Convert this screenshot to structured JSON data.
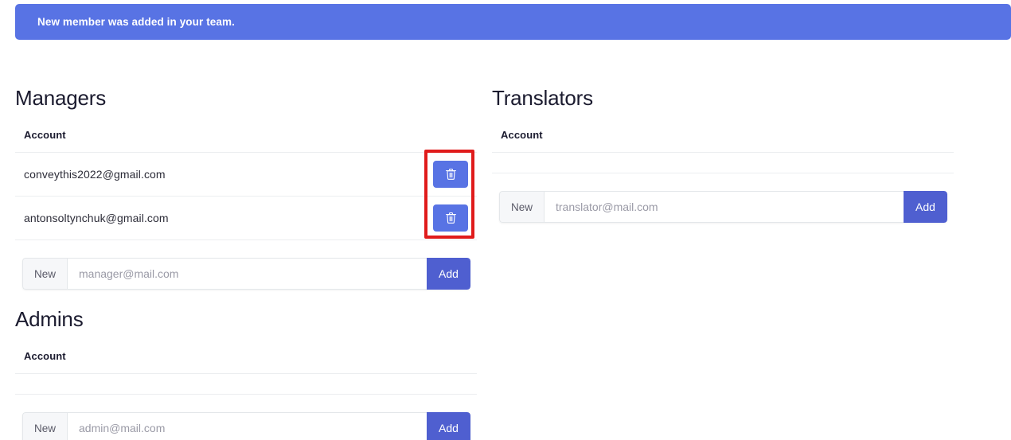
{
  "alert": {
    "message": "New member was added in your team.",
    "background_color": "#5873e4",
    "text_color": "#ffffff"
  },
  "colors": {
    "primary_button": "#4f5fd0",
    "delete_button": "#5873e4",
    "annotation_highlight": "#e01b1b",
    "heading": "#1b1b2f",
    "divider": "#eceef0"
  },
  "sections": {
    "managers": {
      "title": "Managers",
      "column_header": "Account",
      "rows": [
        {
          "email": "conveythis2022@gmail.com",
          "delete_icon": "trash-icon"
        },
        {
          "email": "antonsoltynchuk@gmail.com",
          "delete_icon": "trash-icon"
        }
      ],
      "new_row": {
        "prefix_label": "New",
        "placeholder": "manager@mail.com",
        "value": "",
        "add_label": "Add"
      }
    },
    "admins": {
      "title": "Admins",
      "column_header": "Account",
      "rows": [],
      "new_row": {
        "prefix_label": "New",
        "placeholder": "admin@mail.com",
        "value": "",
        "add_label": "Add"
      }
    },
    "translators": {
      "title": "Translators",
      "column_header": "Account",
      "rows": [],
      "new_row": {
        "prefix_label": "New",
        "placeholder": "translator@mail.com",
        "value": "",
        "add_label": "Add"
      }
    }
  }
}
